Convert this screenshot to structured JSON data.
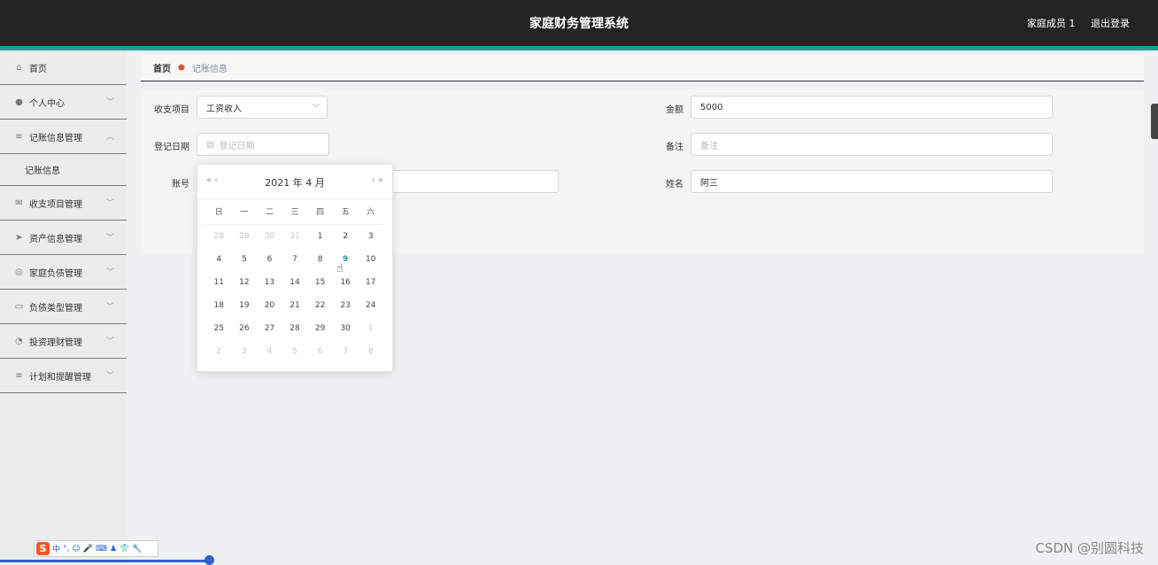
{
  "header": {
    "title": "家庭财务管理系统",
    "user": "家庭成员 1",
    "logout": "退出登录"
  },
  "sidebar": {
    "items": [
      {
        "label": "首页",
        "icon": "home-icon"
      },
      {
        "label": "个人中心",
        "icon": "user-icon"
      },
      {
        "label": "记账信息管理",
        "icon": "list-icon"
      },
      {
        "label": "记账信息",
        "sub": true
      },
      {
        "label": "收支项目管理",
        "icon": "mail-icon"
      },
      {
        "label": "资产信息管理",
        "icon": "send-icon"
      },
      {
        "label": "家庭负债管理",
        "icon": "compass-icon"
      },
      {
        "label": "负债类型管理",
        "icon": "card-icon"
      },
      {
        "label": "投资理财管理",
        "icon": "gauge-icon"
      },
      {
        "label": "计划和提醒管理",
        "icon": "list-icon"
      }
    ]
  },
  "breadcrumb": {
    "home": "首页",
    "current": "记账信息"
  },
  "form": {
    "category_label": "收支项目",
    "category_value": "工资收入",
    "amount_label": "金额",
    "amount_value": "5000",
    "date_label": "登记日期",
    "date_placeholder": "登记日期",
    "note_label": "备注",
    "note_placeholder": "备注",
    "account_label": "账号",
    "name_label": "姓名",
    "name_value": "阿三"
  },
  "datepicker": {
    "title": "2021 年  4 月",
    "prev": "«  ‹",
    "next": "›  »",
    "weekdays": [
      "日",
      "一",
      "二",
      "三",
      "四",
      "五",
      "六"
    ],
    "rows": [
      [
        "28",
        "29",
        "30",
        "31",
        "1",
        "2",
        "3"
      ],
      [
        "4",
        "5",
        "6",
        "7",
        "8",
        "9",
        "10"
      ],
      [
        "11",
        "12",
        "13",
        "14",
        "15",
        "16",
        "17"
      ],
      [
        "18",
        "19",
        "20",
        "21",
        "22",
        "23",
        "24"
      ],
      [
        "25",
        "26",
        "27",
        "28",
        "29",
        "30",
        "1"
      ],
      [
        "2",
        "3",
        "4",
        "5",
        "6",
        "7",
        "8"
      ]
    ],
    "today": "9"
  },
  "ime": {
    "logo": "S",
    "mode": "中"
  },
  "watermark": "CSDN @别圆科技"
}
